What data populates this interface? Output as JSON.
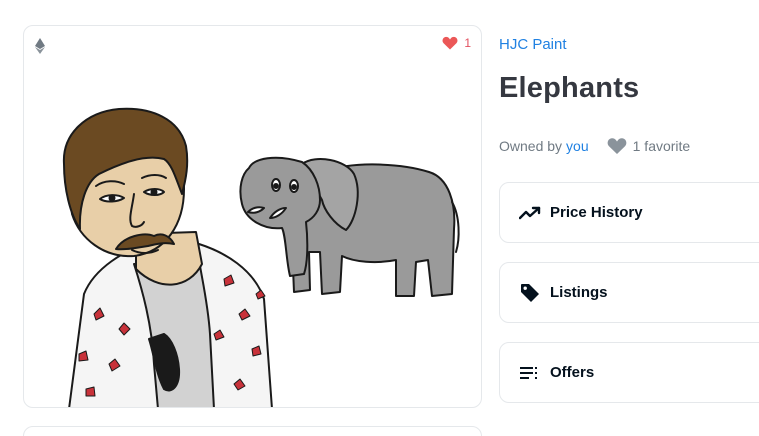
{
  "item": {
    "collection": "HJC Paint",
    "title": "Elephants",
    "owned_by_prefix": "Owned by",
    "owner": "you",
    "favorites_text": "1 favorite",
    "favorite_count": "1"
  },
  "panels": [
    {
      "label": "Price History",
      "icon": "trending-up-icon"
    },
    {
      "label": "Listings",
      "icon": "tag-icon"
    },
    {
      "label": "Offers",
      "icon": "list-icon"
    }
  ],
  "colors": {
    "link_blue": "#2081e2",
    "heart_red": "#eb5757",
    "heart_grey": "#8a939b",
    "text_dark": "#353840",
    "border": "#e5e8eb"
  }
}
